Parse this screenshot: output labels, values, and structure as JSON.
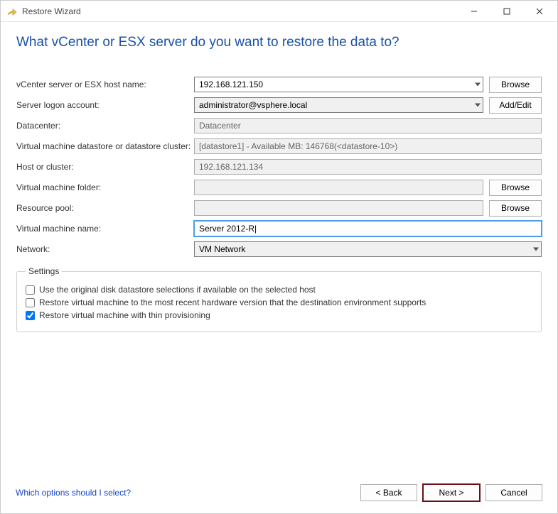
{
  "window": {
    "title": "Restore Wizard"
  },
  "heading": "What vCenter or ESX server do you want to restore the data to?",
  "labels": {
    "vcenter": "vCenter server or ESX host name:",
    "logon": "Server logon account:",
    "datacenter": "Datacenter:",
    "datastore": "Virtual machine datastore or datastore cluster:",
    "host": "Host or cluster:",
    "vmfolder": "Virtual machine folder:",
    "respool": "Resource pool:",
    "vmname": "Virtual machine name:",
    "network": "Network:"
  },
  "values": {
    "vcenter": "192.168.121.150",
    "logon": "administrator@vsphere.local",
    "datacenter": "Datacenter",
    "datastore": "[datastore1] - Available MB: 146768(<datastore-10>)",
    "host": "192.168.121.134",
    "vmfolder": "",
    "respool": "",
    "vmname": "Server 2012-R|",
    "network": "VM Network"
  },
  "buttons": {
    "browse": "Browse",
    "addedit": "Add/Edit",
    "back": "< Back",
    "next": "Next >",
    "cancel": "Cancel"
  },
  "settings": {
    "legend": "Settings",
    "opt1": "Use the original disk datastore selections if available on the selected host",
    "opt2": "Restore virtual machine to the most recent hardware version that the destination environment supports",
    "opt3": "Restore virtual machine with thin provisioning"
  },
  "help": "Which options should I select?"
}
